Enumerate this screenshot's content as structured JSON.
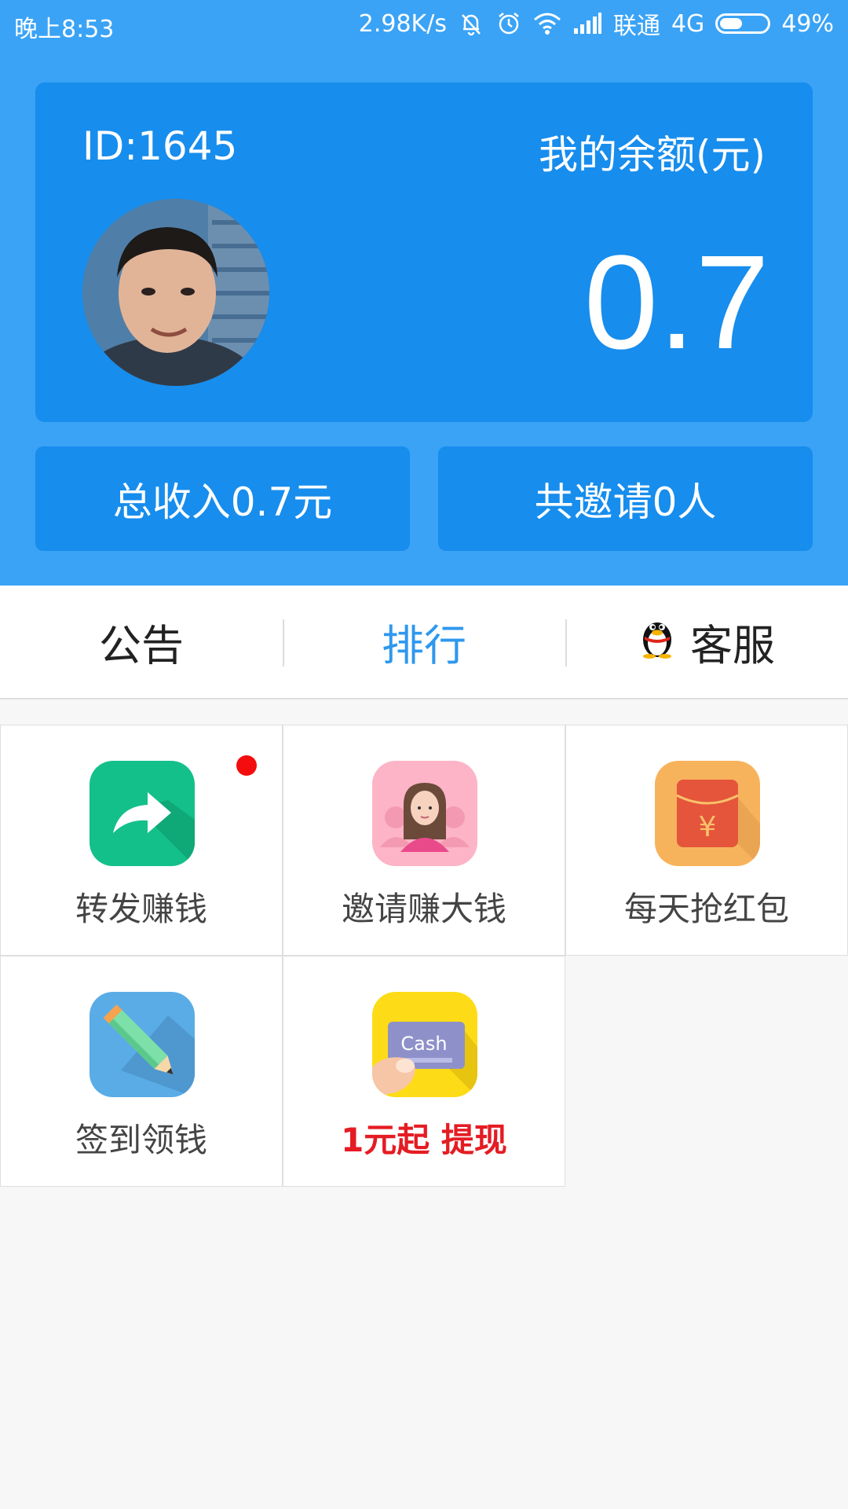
{
  "status_bar": {
    "time": "晚上8:53",
    "network_speed": "2.98K/s",
    "carrier": "联通",
    "network_type": "4G",
    "battery_percent": "49%",
    "battery_level": 0.49,
    "icons": [
      "mute-bell-icon",
      "alarm-icon",
      "wifi-icon",
      "signal-icon",
      "battery-icon"
    ]
  },
  "account": {
    "user_id": "ID:1645",
    "balance_label": "我的余额(元)",
    "balance_value": "0.7"
  },
  "stats": {
    "total_income": "总收入0.7元",
    "total_invites": "共邀请0人"
  },
  "tabs": [
    {
      "label": "公告",
      "active": false
    },
    {
      "label": "排行",
      "active": true
    },
    {
      "label": "客服",
      "active": false,
      "icon": "qq-penguin-icon"
    }
  ],
  "grid": [
    {
      "label": "转发赚钱",
      "icon": "share-arrow-icon",
      "color": "#14c08a",
      "badge": true
    },
    {
      "label": "邀请赚大钱",
      "icon": "invite-person-icon",
      "color": "#fdb4c7",
      "badge": false
    },
    {
      "label": "每天抢红包",
      "icon": "red-envelope-icon",
      "color": "#f7b35c",
      "badge": false
    },
    {
      "label": "签到领钱",
      "icon": "pencil-icon",
      "color": "#5aace6",
      "badge": false
    },
    {
      "label": "1元起 提现",
      "icon": "cash-card-icon",
      "color": "#fddc17",
      "badge": false,
      "highlight": "#e51c23"
    }
  ],
  "colors": {
    "header_bg": "#3aa3f6",
    "card_bg": "#178ded",
    "active_tab": "#2e98ee",
    "badge": "#f40d0d"
  }
}
